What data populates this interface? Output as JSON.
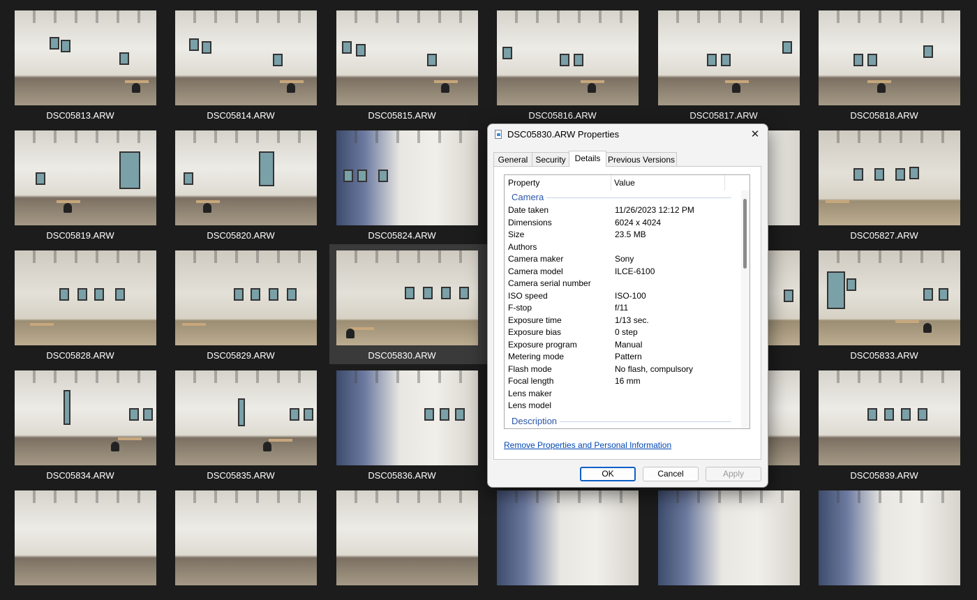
{
  "thumbnails": [
    {
      "name": "DSC05813.ARW"
    },
    {
      "name": "DSC05814.ARW"
    },
    {
      "name": "DSC05815.ARW"
    },
    {
      "name": "DSC05816.ARW"
    },
    {
      "name": "DSC05817.ARW"
    },
    {
      "name": "DSC05818.ARW"
    },
    {
      "name": "DSC05819.ARW"
    },
    {
      "name": "DSC05820.ARW"
    },
    {
      "name": "DSC05824.ARW"
    },
    {
      "name": ""
    },
    {
      "name": ""
    },
    {
      "name": "DSC05827.ARW"
    },
    {
      "name": "DSC05828.ARW"
    },
    {
      "name": "DSC05829.ARW"
    },
    {
      "name": "DSC05830.ARW"
    },
    {
      "name": ""
    },
    {
      "name": ""
    },
    {
      "name": "DSC05833.ARW"
    },
    {
      "name": "DSC05834.ARW"
    },
    {
      "name": "DSC05835.ARW"
    },
    {
      "name": "DSC05836.ARW"
    },
    {
      "name": ""
    },
    {
      "name": ""
    },
    {
      "name": "DSC05839.ARW"
    },
    {
      "name": ""
    },
    {
      "name": ""
    },
    {
      "name": ""
    },
    {
      "name": ""
    },
    {
      "name": ""
    },
    {
      "name": ""
    }
  ],
  "dialog": {
    "title": "DSC05830.ARW Properties",
    "close_glyph": "✕",
    "tabs": [
      "General",
      "Security",
      "Details",
      "Previous Versions"
    ],
    "active_tab": "Details",
    "columns": {
      "property": "Property",
      "value": "Value"
    },
    "groups": {
      "camera": "Camera",
      "description": "Description"
    },
    "rows": [
      {
        "k": "Date taken",
        "v": "11/26/2023 12:12 PM"
      },
      {
        "k": "Dimensions",
        "v": "6024 x 4024"
      },
      {
        "k": "Size",
        "v": "23.5 MB"
      },
      {
        "k": "Authors",
        "v": ""
      },
      {
        "k": "Camera maker",
        "v": "Sony"
      },
      {
        "k": "Camera model",
        "v": "ILCE-6100"
      },
      {
        "k": "Camera serial number",
        "v": ""
      },
      {
        "k": "ISO speed",
        "v": "ISO-100"
      },
      {
        "k": "F-stop",
        "v": "f/11"
      },
      {
        "k": "Exposure time",
        "v": "1/13 sec."
      },
      {
        "k": "Exposure bias",
        "v": "0 step"
      },
      {
        "k": "Exposure program",
        "v": "Manual"
      },
      {
        "k": "Metering mode",
        "v": "Pattern"
      },
      {
        "k": "Flash mode",
        "v": "No flash, compulsory"
      },
      {
        "k": "Focal length",
        "v": "16 mm"
      },
      {
        "k": "Lens maker",
        "v": ""
      },
      {
        "k": "Lens model",
        "v": ""
      }
    ],
    "remove_link": "Remove Properties and Personal Information",
    "buttons": {
      "ok": "OK",
      "cancel": "Cancel",
      "apply": "Apply"
    }
  }
}
